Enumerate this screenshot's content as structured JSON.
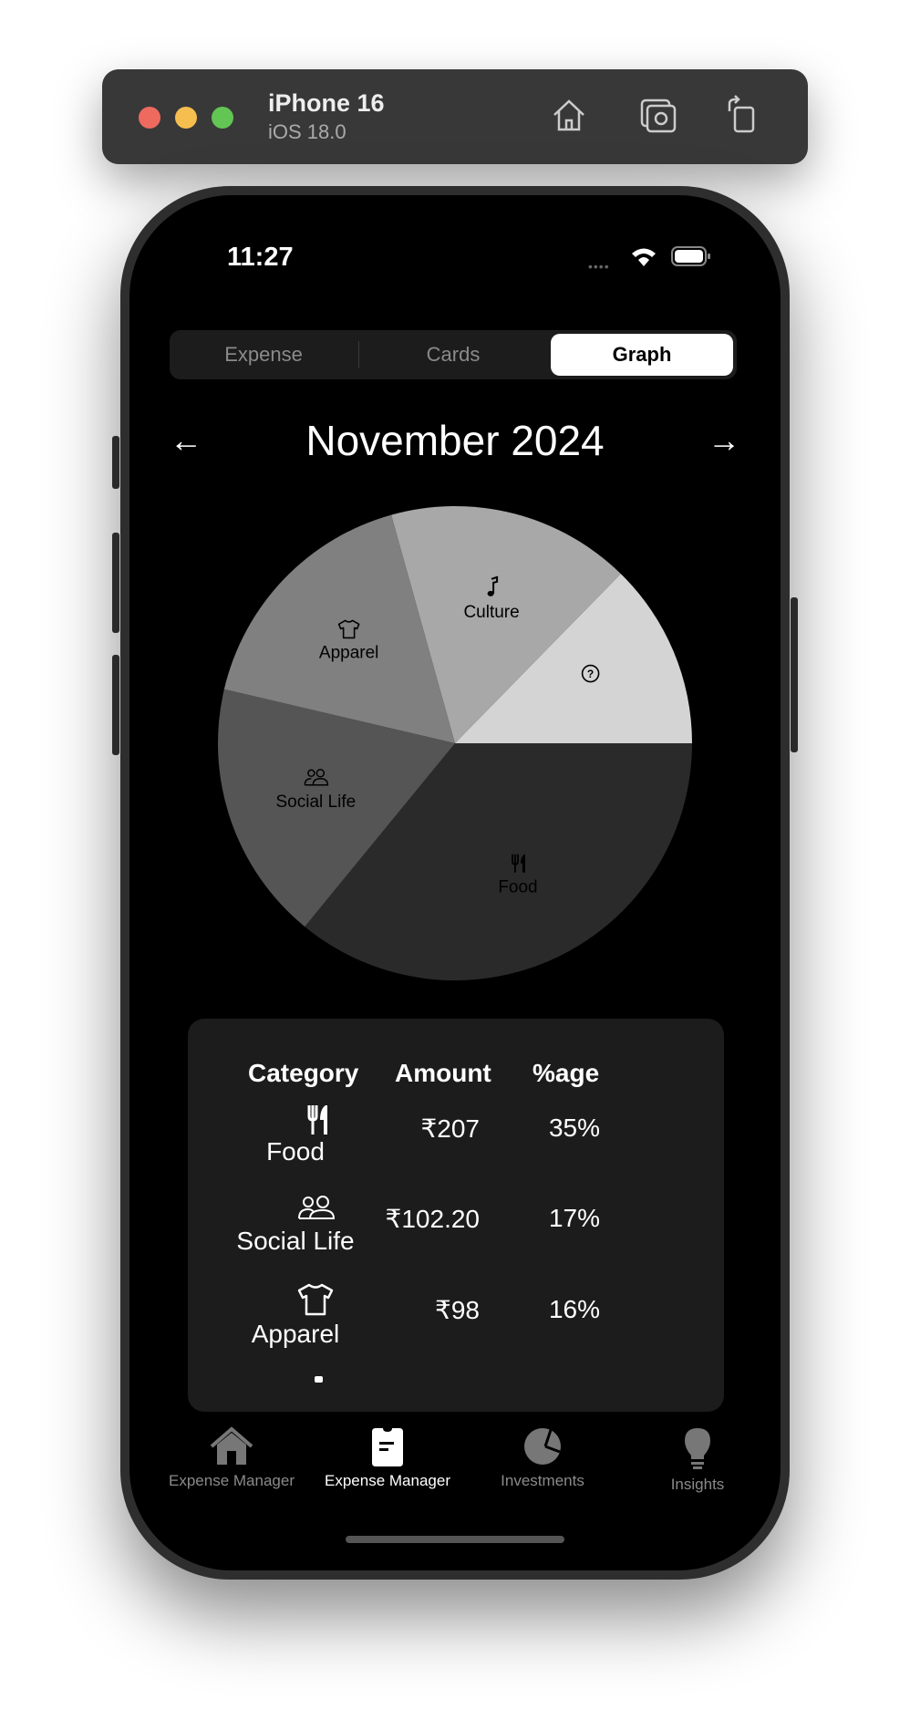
{
  "simulator": {
    "device": "iPhone 16",
    "os": "iOS 18.0",
    "icons": [
      "home-icon",
      "screenshot-icon",
      "rotate-icon"
    ]
  },
  "status_bar": {
    "time": "11:27"
  },
  "segmented": {
    "items": [
      "Expense",
      "Cards",
      "Graph"
    ],
    "selected": "Graph"
  },
  "header": {
    "month": "November 2024",
    "prev": "←",
    "next": "→"
  },
  "chart_data": {
    "type": "pie",
    "title": "November 2024",
    "categories": [
      "Food",
      "Social Life",
      "Apparel",
      "Culture",
      ""
    ],
    "icons": [
      "fork-knife-icon",
      "people-icon",
      "tshirt-icon",
      "music-note-icon",
      "question-icon"
    ],
    "values": [
      207,
      102.2,
      98,
      96,
      73
    ],
    "colors": [
      "#2a2a2a",
      "#555555",
      "#808080",
      "#a8a8a8",
      "#d4d4d4"
    ]
  },
  "table": {
    "headers": [
      "Category",
      "Amount",
      "%age"
    ],
    "rows": [
      {
        "category": "Food",
        "icon": "fork-knife-icon",
        "amount": "₹207",
        "percent": "35%"
      },
      {
        "category": "Social Life",
        "icon": "people-icon",
        "amount": "₹102.20",
        "percent": "17%"
      },
      {
        "category": "Apparel",
        "icon": "tshirt-icon",
        "amount": "₹98",
        "percent": "16%"
      }
    ]
  },
  "tabbar": {
    "items": [
      {
        "label": "Expense Manager",
        "icon": "house-icon",
        "active": false
      },
      {
        "label": "Expense Manager",
        "icon": "clipboard-icon",
        "active": true
      },
      {
        "label": "Investments",
        "icon": "pie-chart-icon",
        "active": false
      },
      {
        "label": "Insights",
        "icon": "lightbulb-icon",
        "active": false
      }
    ]
  }
}
